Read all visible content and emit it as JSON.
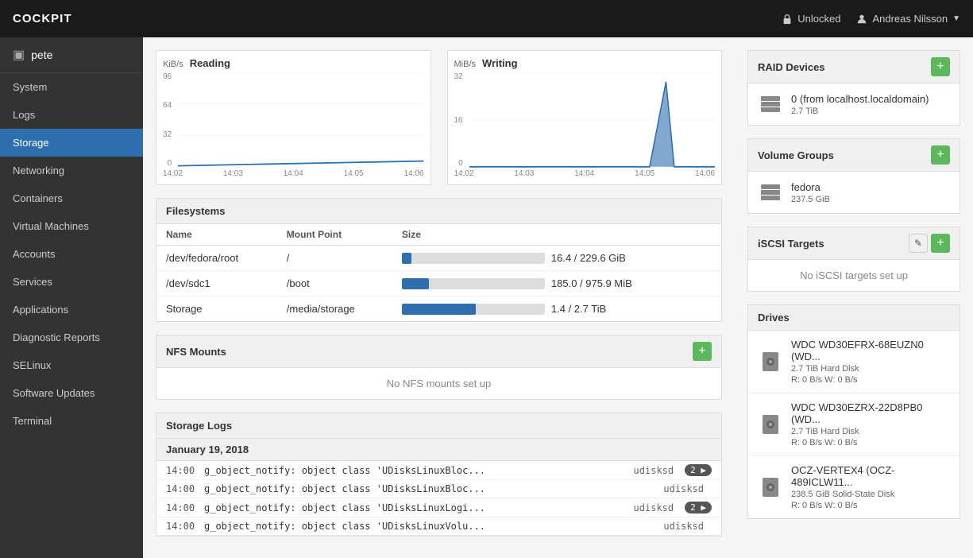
{
  "app": {
    "brand": "COCKPIT"
  },
  "navbar": {
    "unlocked_label": "Unlocked",
    "user_label": "Andreas Nilsson"
  },
  "sidebar": {
    "host": "pete",
    "items": [
      {
        "label": "System",
        "id": "system",
        "active": false
      },
      {
        "label": "Logs",
        "id": "logs",
        "active": false
      },
      {
        "label": "Storage",
        "id": "storage",
        "active": true
      },
      {
        "label": "Networking",
        "id": "networking",
        "active": false
      },
      {
        "label": "Containers",
        "id": "containers",
        "active": false
      },
      {
        "label": "Virtual Machines",
        "id": "virtual-machines",
        "active": false
      },
      {
        "label": "Accounts",
        "id": "accounts",
        "active": false
      },
      {
        "label": "Services",
        "id": "services",
        "active": false
      },
      {
        "label": "Applications",
        "id": "applications",
        "active": false
      },
      {
        "label": "Diagnostic Reports",
        "id": "diagnostic-reports",
        "active": false
      },
      {
        "label": "SELinux",
        "id": "selinux",
        "active": false
      },
      {
        "label": "Software Updates",
        "id": "software-updates",
        "active": false
      },
      {
        "label": "Terminal",
        "id": "terminal",
        "active": false
      }
    ]
  },
  "reading_chart": {
    "unit": "KiB/s",
    "title": "Reading",
    "y_labels": [
      "96",
      "64",
      "32",
      "0"
    ],
    "x_labels": [
      "14:02",
      "14:03",
      "14:04",
      "14:05",
      "14:06"
    ]
  },
  "writing_chart": {
    "unit": "MiB/s",
    "title": "Writing",
    "y_labels": [
      "32",
      "16",
      "0"
    ],
    "x_labels": [
      "14:02",
      "14:03",
      "14:04",
      "14:05",
      "14:06"
    ]
  },
  "filesystems": {
    "title": "Filesystems",
    "columns": [
      "Name",
      "Mount Point",
      "Size"
    ],
    "rows": [
      {
        "name": "/dev/fedora/root",
        "mount": "/",
        "size_text": "16.4 / 229.6 GiB",
        "pct": 7
      },
      {
        "name": "/dev/sdc1",
        "mount": "/boot",
        "size_text": "185.0 / 975.9 MiB",
        "pct": 19
      },
      {
        "name": "Storage",
        "mount": "/media/storage",
        "size_text": "1.4 / 2.7 TiB",
        "pct": 52
      }
    ]
  },
  "nfs_mounts": {
    "title": "NFS Mounts",
    "no_data": "No NFS mounts set up"
  },
  "storage_logs": {
    "title": "Storage Logs",
    "date": "January 19, 2018",
    "rows": [
      {
        "time": "14:00",
        "msg": "g_object_notify: object class 'UDisksLinuxBloc...",
        "source": "udisksd",
        "badge": "2"
      },
      {
        "time": "14:00",
        "msg": "g_object_notify: object class 'UDisksLinuxBloc...",
        "source": "udisksd",
        "badge": null
      },
      {
        "time": "14:00",
        "msg": "g_object_notify: object class 'UDisksLinuxLogi...",
        "source": "udisksd",
        "badge": "2"
      },
      {
        "time": "14:00",
        "msg": "g_object_notify: object class 'UDisksLinuxVolu...",
        "source": "udisksd",
        "badge": null
      }
    ]
  },
  "right_panel": {
    "raid": {
      "title": "RAID Devices",
      "items": [
        {
          "name": "0 (from localhost.localdomain)",
          "sub": "2.7 TiB"
        }
      ]
    },
    "volume_groups": {
      "title": "Volume Groups",
      "items": [
        {
          "name": "fedora",
          "sub": "237.5 GiB"
        }
      ]
    },
    "iscsi": {
      "title": "iSCSI Targets",
      "no_data": "No iSCSI targets set up"
    },
    "drives": {
      "title": "Drives",
      "items": [
        {
          "name": "WDC WD30EFRX-68EUZN0 (WD...",
          "sub": "2.7 TiB Hard Disk",
          "io": "R: 0 B/s     W: 0 B/s"
        },
        {
          "name": "WDC WD30EZRX-22D8PB0 (WD...",
          "sub": "2.7 TiB Hard Disk",
          "io": "R: 0 B/s     W: 0 B/s"
        },
        {
          "name": "OCZ-VERTEX4 (OCZ-489ICLW11...",
          "sub": "238.5 GiB Solid-State Disk",
          "io": "R: 0 B/s     W: 0 B/s"
        }
      ]
    }
  }
}
